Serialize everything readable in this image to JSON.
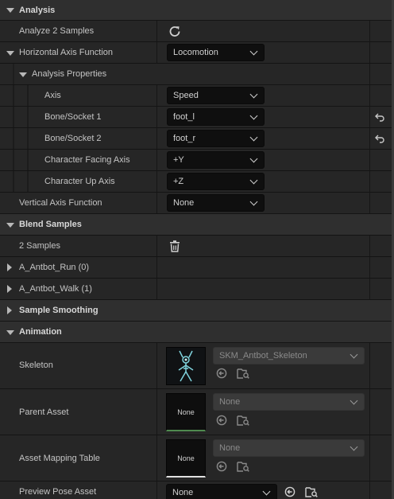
{
  "categories": {
    "analysis": "Analysis",
    "blend_samples": "Blend Samples",
    "sample_smoothing": "Sample Smoothing",
    "animation": "Animation"
  },
  "analysis": {
    "analyze_label": "Analyze 2 Samples",
    "horizontal_axis_label": "Horizontal Axis Function",
    "horizontal_axis_value": "Locomotion",
    "properties_label": "Analysis Properties",
    "axis_label": "Axis",
    "axis_value": "Speed",
    "bone1_label": "Bone/Socket 1",
    "bone1_value": "foot_l",
    "bone2_label": "Bone/Socket 2",
    "bone2_value": "foot_r",
    "facing_label": "Character Facing Axis",
    "facing_value": "+Y",
    "up_label": "Character Up Axis",
    "up_value": "+Z",
    "vertical_axis_label": "Vertical Axis Function",
    "vertical_axis_value": "None"
  },
  "blend_samples": {
    "count_label": "2 Samples",
    "items": [
      "A_Antbot_Run (0)",
      "A_Antbot_Walk (1)"
    ]
  },
  "animation": {
    "skeleton_label": "Skeleton",
    "skeleton_value": "SKM_Antbot_Skeleton",
    "parent_label": "Parent Asset",
    "parent_value": "None",
    "parent_thumb": "None",
    "mapping_label": "Asset Mapping Table",
    "mapping_value": "None",
    "mapping_thumb": "None",
    "preview_label": "Preview Pose Asset",
    "preview_value": "None"
  },
  "colors": {
    "category_bg": "#2f2f2f",
    "row_bg": "#262626",
    "combo_bg": "#0f0f0f",
    "parent_underline": "#4f8a4f",
    "mapping_underline": "#e0e0e0",
    "skeleton_accent": "#7fd3dd"
  },
  "icons": [
    "refresh-icon",
    "reset-arrow-icon",
    "trash-icon",
    "browse-arrow-icon",
    "find-in-folder-icon"
  ]
}
